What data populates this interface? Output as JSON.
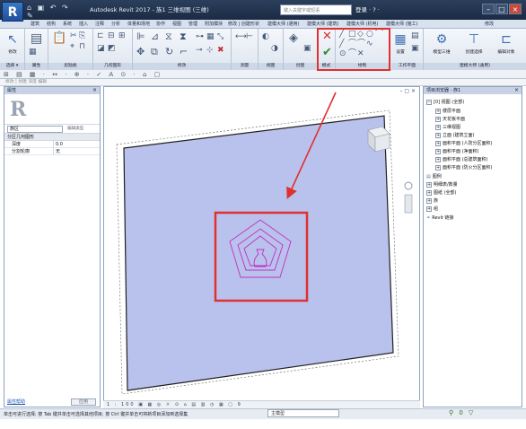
{
  "app": {
    "logo": "R",
    "quick_access": "⌂ ▣ ↶ ↷ ✎",
    "title": "Autodesk Revit 2017   -   族1   三维视图 (三维)",
    "search_placeholder": "键入关键字或短语",
    "user_area": "登录   ·   ?   ·",
    "win_buttons": [
      "–",
      "□",
      "×"
    ]
  },
  "tabs": [
    "建筑",
    "结构",
    "系统",
    "插入",
    "注释",
    "分析",
    "体量和场地",
    "协作",
    "视图",
    "管理",
    "附加模块",
    "修改 | 创建形状",
    "建模大师 (通用)",
    "建模大师 (建筑)",
    "建模大师 (机电)",
    "建模大师 (施工)",
    "修改"
  ],
  "ribbon": {
    "panels": [
      {
        "id": "select",
        "label": "选择 ▾",
        "btn": "修改"
      },
      {
        "id": "properties",
        "label": "属性"
      },
      {
        "id": "clipboard",
        "label": "剪贴板"
      },
      {
        "id": "geometry",
        "label": "几何图形"
      },
      {
        "id": "modify",
        "label": "修改"
      },
      {
        "id": "measure",
        "label": "测量"
      },
      {
        "id": "view",
        "label": "视图"
      },
      {
        "id": "create",
        "label": "创建"
      },
      {
        "id": "mode",
        "label": "模式"
      },
      {
        "id": "draw",
        "label": "绘制"
      },
      {
        "id": "workplane",
        "label": "工作平面"
      },
      {
        "id": "bim",
        "label": "建模大师 (通用)"
      }
    ],
    "draw_tools": [
      "╱",
      "□",
      "◇",
      "○",
      "⌒",
      "╱",
      "⌒",
      "⌒",
      "∿",
      "⊙",
      "⌒",
      "✕"
    ],
    "workplane_btn": "设置",
    "bim_btns": [
      "模型三维",
      "创建选择",
      "编辑对象"
    ]
  },
  "toolbar": "⊞ ▤ ▦ · ↔ · ⊕ · ✓ A ⊙ · ⌂ ▢",
  "optionbar": "修改 | 创建   深度 编辑",
  "properties": {
    "title": "属性",
    "type_dropdown": "族区",
    "edit_type": "编辑类型",
    "section": "分区几何图形",
    "rows": [
      {
        "key": "深度",
        "value": "0.0"
      },
      {
        "key": "分割轮廓",
        "value": "无"
      }
    ],
    "help": "属性帮助",
    "apply": "应用"
  },
  "canvas": {
    "controls": "– ▢ ×",
    "scale": "1 : 100",
    "view_controls": "▣ ▦ ◎ ☼ ⊙ ⌂ ▤ ▥ ◷ ▦ ▢ 9"
  },
  "browser": {
    "title": "项目浏览器 - 族1",
    "items": [
      {
        "level": 0,
        "pm": "−",
        "label": "[0] 视图 (全部)"
      },
      {
        "level": 1,
        "pm": "+",
        "label": "楼层平面"
      },
      {
        "level": 1,
        "pm": "+",
        "label": "天花板平面"
      },
      {
        "level": 1,
        "pm": "+",
        "label": "三维视图"
      },
      {
        "level": 1,
        "pm": "+",
        "label": "立面 (建筑立面)"
      },
      {
        "level": 1,
        "pm": "+",
        "label": "面积平面 (人防分区面积)"
      },
      {
        "level": 1,
        "pm": "+",
        "label": "面积平面 (净面积)"
      },
      {
        "level": 1,
        "pm": "+",
        "label": "面积平面 (总建筑面积)"
      },
      {
        "level": 1,
        "pm": "+",
        "label": "面积平面 (防火分区面积)"
      },
      {
        "level": 0,
        "pm": "",
        "label": "图例"
      },
      {
        "level": 0,
        "pm": "+",
        "label": "明细表/数量"
      },
      {
        "level": 0,
        "pm": "+",
        "label": "图纸 (全部)"
      },
      {
        "level": 0,
        "pm": "+",
        "label": "族"
      },
      {
        "level": 0,
        "pm": "+",
        "label": "组"
      },
      {
        "level": 0,
        "pm": "",
        "label": "Revit 链接"
      }
    ]
  },
  "status": {
    "message": "单击可进行选择; 按 Tab 键并单击可选择其他项目; 按 Ctrl 键并单击可将新项目添加到选择集",
    "selector": "主模型",
    "right_icons": "⚲ 0 ▽"
  },
  "colors": {
    "highlight": "#e03030",
    "arrow": "#e03030",
    "mass_fill": "#b9c2ec",
    "shape_stroke": "#c030c0"
  }
}
